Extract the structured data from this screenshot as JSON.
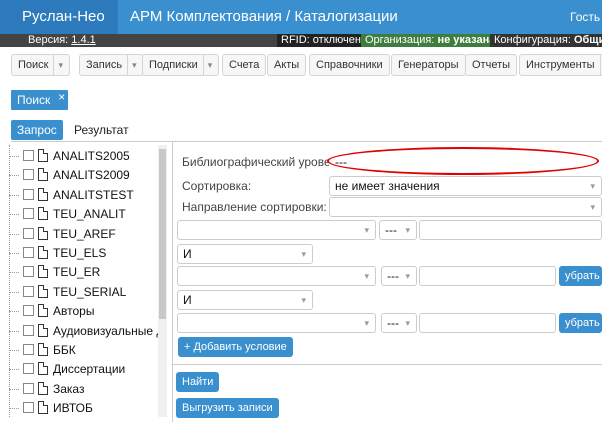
{
  "header": {
    "brand": "Руслан-Нео",
    "title": "АРМ Комплектования / Каталогизации",
    "user": "Гость"
  },
  "status": {
    "version_label": "Версия:",
    "version_value": "1.4.1",
    "rfid": "RFID: отключен",
    "org_label": "Организация:",
    "org_value": "не указана",
    "conf_label": "Конфигурация:",
    "conf_value": "Общи"
  },
  "menu": {
    "items": [
      "Поиск",
      "Запись",
      "Подписки",
      "Счета",
      "Акты",
      "Справочники",
      "Генераторы",
      "Отчеты",
      "Инструменты"
    ]
  },
  "open_tab": {
    "label": "Поиск",
    "close": "×"
  },
  "subtabs": {
    "request": "Запрос",
    "result": "Результат"
  },
  "tree": {
    "items": [
      "ANALITS2005",
      "ANALITS2009",
      "ANALITSTEST",
      "TEU_ANALIT",
      "TEU_AREF",
      "TEU_ELS",
      "TEU_ER",
      "TEU_SERIAL",
      "Авторы",
      "Аудиовизуальные док",
      "ББК",
      "Диссертации",
      "Заказ",
      "ИВТОБ"
    ]
  },
  "form": {
    "bib_level_label": "Библиографический уровень:",
    "bib_level_value": "---",
    "sort_label": "Сортировка:",
    "sort_value": "не имеет значения",
    "sort_dir_label": "Направление сортировки:",
    "sort_dir_value": "",
    "op_value": "---",
    "logic_value": "И",
    "remove_label": "убрать",
    "add_condition": "+ Добавить условие",
    "find": "Найти",
    "export": "Выгрузить записи"
  }
}
